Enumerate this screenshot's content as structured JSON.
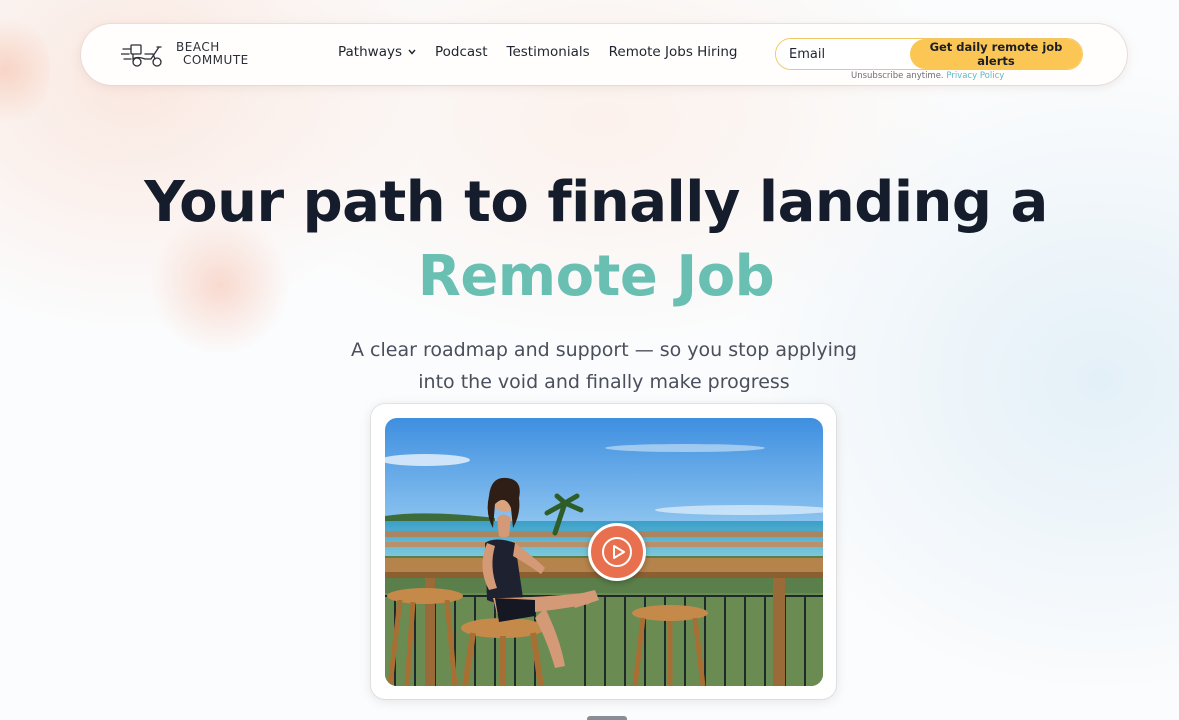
{
  "brand": {
    "line1": "BEACH",
    "line2": "COMMUTE"
  },
  "nav": {
    "pathways": "Pathways",
    "podcast": "Podcast",
    "testimonials": "Testimonials",
    "remote_jobs": "Remote Jobs Hiring"
  },
  "signup": {
    "email_placeholder": "Email",
    "cta": "Get daily remote job alerts",
    "fineprint": "Unsubscribe anytime.",
    "privacy": "Privacy Policy"
  },
  "hero": {
    "title_line1": "Your path to finally landing a",
    "title_accent": "Remote Job",
    "sub_line1": "A clear roadmap and support — so you stop applying",
    "sub_line2": "into the void and finally make progress"
  },
  "icons": {
    "logo": "scooter-logo-icon",
    "chevron": "chevron-down-icon",
    "play": "play-icon"
  },
  "colors": {
    "accent_teal": "#69bfb2",
    "cta_yellow": "#fbc653",
    "play_orange": "#e9704e",
    "heading": "#151c2c"
  }
}
